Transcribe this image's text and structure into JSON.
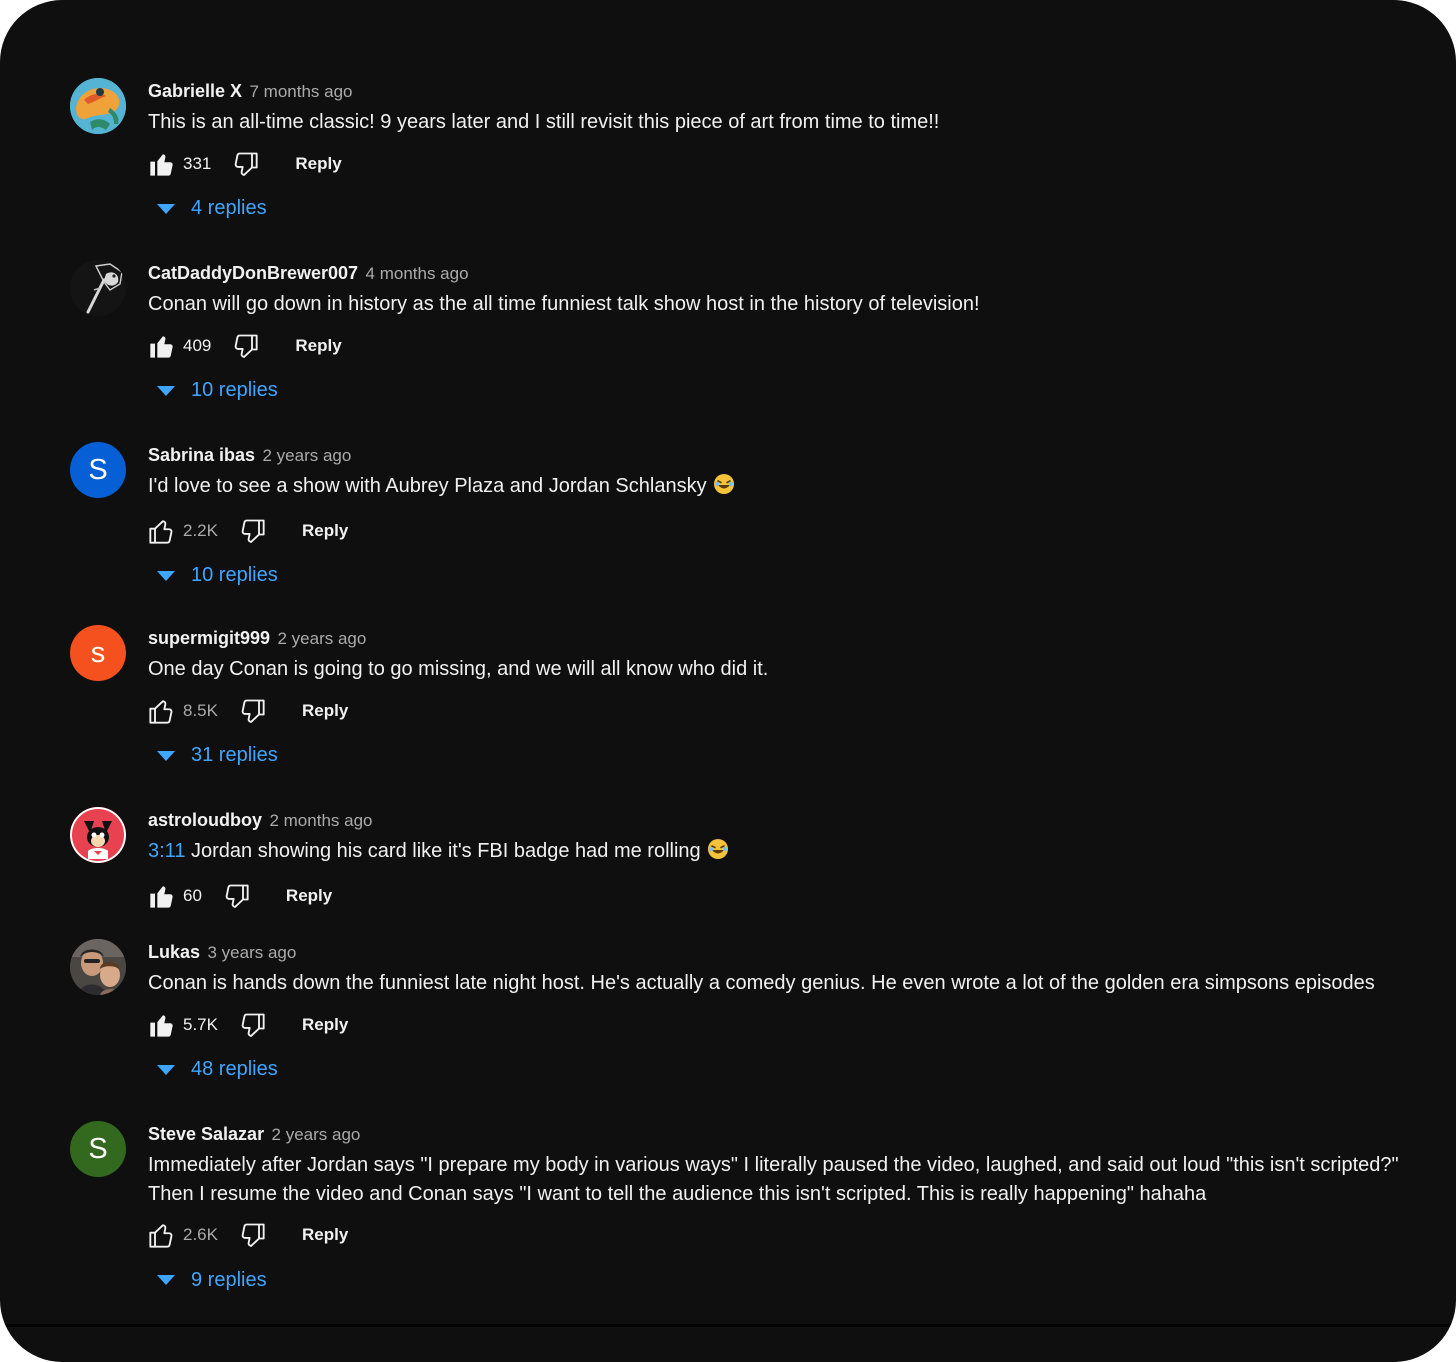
{
  "reply_label": "Reply",
  "colors": {
    "background": "#0f0f0f",
    "text": "#f1f1f1",
    "secondary_text": "#aaaaaa",
    "link": "#3ea6ff"
  },
  "comments": [
    {
      "author": "Gabrielle X",
      "time": "7 months ago",
      "text": "This is an all-time classic! 9 years later and I still revisit this piece of art from time to time!!",
      "likes": "331",
      "liked": true,
      "replies": "4 replies",
      "avatar": {
        "type": "image",
        "icon": "frog-avatar-icon"
      }
    },
    {
      "author": "CatDaddyDonBrewer007",
      "time": "4 months ago",
      "text": "Conan will go down in history as the all time funniest talk show host in the history of television!",
      "likes": "409",
      "liked": true,
      "replies": "10 replies",
      "avatar": {
        "type": "image",
        "icon": "bird-avatar-icon"
      }
    },
    {
      "author": "Sabrina ibas",
      "time": "2 years ago",
      "text": "I'd love to see a show with Aubrey Plaza and Jordan Schlansky",
      "emoji": "😂",
      "likes": "2.2K",
      "liked": false,
      "replies": "10 replies",
      "avatar": {
        "type": "letter",
        "letter": "S",
        "color": "#065fd4"
      }
    },
    {
      "author": "supermigit999",
      "time": "2 years ago",
      "text": "One day Conan is going to go missing, and we will all know who did it.",
      "likes": "8.5K",
      "liked": false,
      "replies": "31 replies",
      "avatar": {
        "type": "letter",
        "letter": "s",
        "color": "#f4511e"
      }
    },
    {
      "author": "astroloudboy",
      "time": "2 months ago",
      "timestamp": "3:11",
      "text": "Jordan showing his card like it's FBI badge had me rolling",
      "emoji": "😂",
      "likes": "60",
      "liked": true,
      "avatar": {
        "type": "image",
        "icon": "cartoon-avatar-icon"
      }
    },
    {
      "author": "Lukas",
      "time": "3 years ago",
      "text": "Conan is hands down the funniest late night host. He's actually a comedy genius. He even wrote a lot of the golden era simpsons episodes",
      "likes": "5.7K",
      "liked": true,
      "replies": "48 replies",
      "avatar": {
        "type": "image",
        "icon": "photo-avatar-icon"
      }
    },
    {
      "author": "Steve Salazar",
      "time": "2 years ago",
      "text_lines": [
        "Immediately after Jordan says \"I prepare my body in various ways\" I literally paused the video, laughed, and said out loud \"this isn't scripted?\"",
        "Then I resume the video and Conan says \"I want to tell the audience this isn't scripted. This is really happening\" hahaha"
      ],
      "likes": "2.6K",
      "liked": false,
      "replies": "9 replies",
      "avatar": {
        "type": "letter",
        "letter": "S",
        "color": "#33691e"
      }
    }
  ]
}
